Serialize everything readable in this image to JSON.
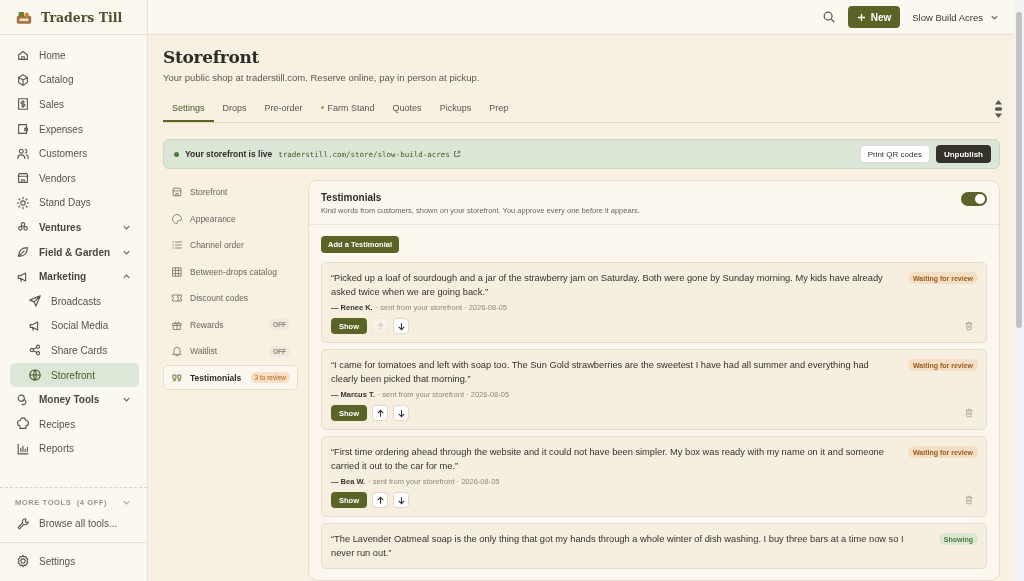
{
  "brand": {
    "name": "Traders Till"
  },
  "sidebar": {
    "items": [
      {
        "label": "Home",
        "selected": false
      },
      {
        "label": "Catalog",
        "selected": false
      },
      {
        "label": "Sales",
        "selected": false
      },
      {
        "label": "Expenses",
        "selected": false
      },
      {
        "label": "Customers",
        "selected": false
      },
      {
        "label": "Vendors",
        "selected": false
      },
      {
        "label": "Stand Days",
        "selected": false
      },
      {
        "label": "Ventures",
        "selected": false,
        "expanded": false
      },
      {
        "label": "Field & Garden",
        "selected": false,
        "expanded": false
      },
      {
        "label": "Marketing",
        "selected": false,
        "expanded": true,
        "children": [
          {
            "label": "Broadcasts",
            "selected": false
          },
          {
            "label": "Social Media",
            "selected": false
          },
          {
            "label": "Share Cards",
            "selected": false
          },
          {
            "label": "Storefront",
            "selected": true
          }
        ]
      },
      {
        "label": "Money Tools",
        "selected": false,
        "expanded": false
      },
      {
        "label": "Recipes",
        "selected": false
      },
      {
        "label": "Reports",
        "selected": false
      }
    ],
    "more_tools": {
      "label": "MORE TOOLS  (4 OFF)",
      "expanded": false
    },
    "browse": "Browse all tools...",
    "settings": "Settings"
  },
  "header": {
    "new_button": "New",
    "account": "Slow Build Acres"
  },
  "page": {
    "title": "Storefront",
    "subtitle": "Your public shop at traderstill.com. Reserve online, pay in person at pickup."
  },
  "tabs": [
    {
      "label": "Settings",
      "selected": true,
      "dot": false
    },
    {
      "label": "Drops",
      "selected": false,
      "dot": false
    },
    {
      "label": "Pre-order",
      "selected": false,
      "dot": false
    },
    {
      "label": "Farm Stand",
      "selected": false,
      "dot": true
    },
    {
      "label": "Quotes",
      "selected": false,
      "dot": false
    },
    {
      "label": "Pickups",
      "selected": false,
      "dot": false
    },
    {
      "label": "Prep",
      "selected": false,
      "dot": false
    }
  ],
  "banner": {
    "live": true,
    "text": "Your storefront is live",
    "link": "traderstill.com/store/slow-build-acres",
    "buttons": [
      "Print QR codes",
      "Unpublish"
    ]
  },
  "subnav": [
    {
      "label": "Storefront",
      "selected": false
    },
    {
      "label": "Appearance",
      "selected": false
    },
    {
      "label": "Channel order",
      "selected": false
    },
    {
      "label": "Between-drops catalog",
      "selected": false
    },
    {
      "label": "Discount codes",
      "selected": false
    },
    {
      "label": "Rewards",
      "selected": false,
      "badge": {
        "text": "OFF",
        "kind": "off"
      }
    },
    {
      "label": "Waitlist",
      "selected": false,
      "badge": {
        "text": "OFF",
        "kind": "off"
      }
    },
    {
      "label": "Testimonials",
      "selected": true,
      "badge": {
        "text": "3 to review",
        "kind": "review"
      }
    }
  ],
  "card": {
    "title": "Testimonials",
    "description": "Kind words from customers, shown on your storefront. You approve every one before it appears.",
    "on": true,
    "add_button": "Add a Testimonial"
  },
  "testimonials": [
    {
      "quote": "“Picked up a loaf of sourdough and a jar of the strawberry jam on Saturday. Both were gone by Sunday morning. My kids have already asked twice when we are going back.”",
      "status": {
        "text": "Waiting for review",
        "kind": "waiting"
      },
      "author": "— Renee K.",
      "meta": "· sent from your storefront · 2026-08-05",
      "show_button": "Show",
      "up_disabled": true,
      "down_disabled": false
    },
    {
      "quote": "“I came for tomatoes and left with soap too. The Sun Gold strawberries are the sweetest I have had all summer and everything had clearly been picked that morning.”",
      "status": {
        "text": "Waiting for review",
        "kind": "waiting"
      },
      "author": "— Marcus T.",
      "meta": "· sent from your storefront · 2026-08-05",
      "show_button": "Show",
      "up_disabled": false,
      "down_disabled": false
    },
    {
      "quote": "“First time ordering ahead through the website and it could not have been simpler. My box was ready with my name on it and someone carried it out to the car for me.”",
      "status": {
        "text": "Waiting for review",
        "kind": "waiting"
      },
      "author": "— Bea W.",
      "meta": "· sent from your storefront · 2026-08-05",
      "show_button": "Show",
      "up_disabled": false,
      "down_disabled": false
    },
    {
      "quote": "“The Lavender Oatmeal soap is the only thing that got my hands through a whole winter of dish washing. I buy three bars at a time now so I never run out.”",
      "status": {
        "text": "Showing",
        "kind": "showing"
      }
    }
  ]
}
